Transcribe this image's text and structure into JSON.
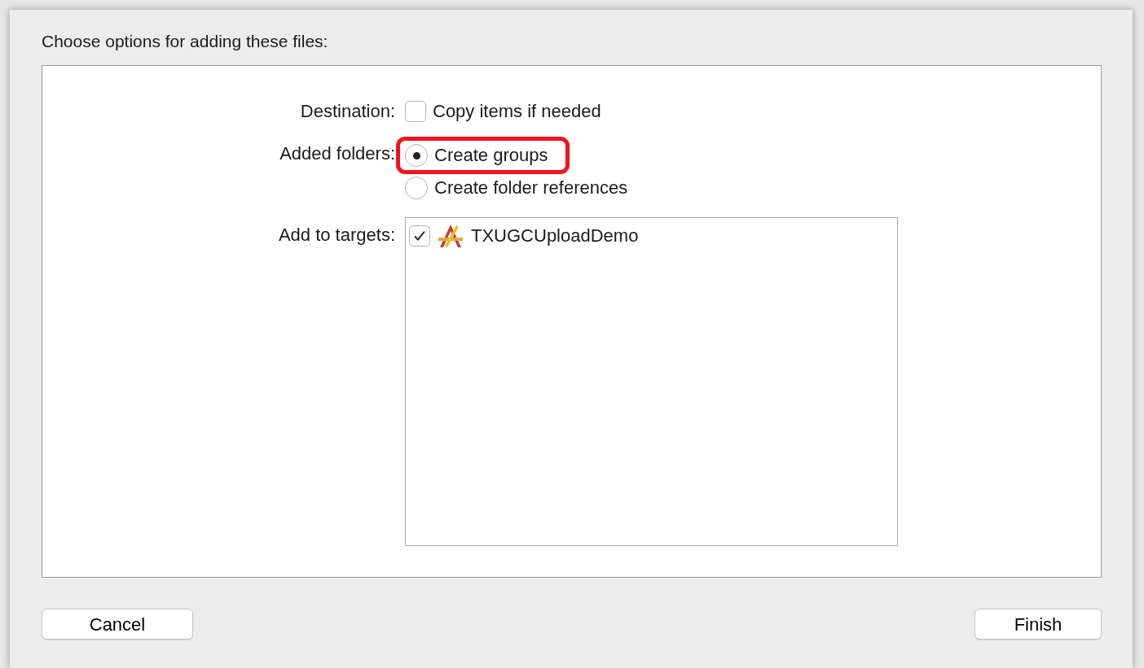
{
  "sheet": {
    "title": "Choose options for adding these files:"
  },
  "destination": {
    "label": "Destination:",
    "option": {
      "label": "Copy items if needed",
      "checked": false
    }
  },
  "added_folders": {
    "label": "Added folders:",
    "options": [
      {
        "label": "Create groups",
        "selected": true,
        "highlighted": true
      },
      {
        "label": "Create folder references",
        "selected": false,
        "highlighted": false
      }
    ]
  },
  "targets": {
    "label": "Add to targets:",
    "items": [
      {
        "name": "TXUGCUploadDemo",
        "checked": true
      }
    ]
  },
  "buttons": [
    {
      "label": "Cancel"
    },
    {
      "label": "Finish"
    }
  ]
}
